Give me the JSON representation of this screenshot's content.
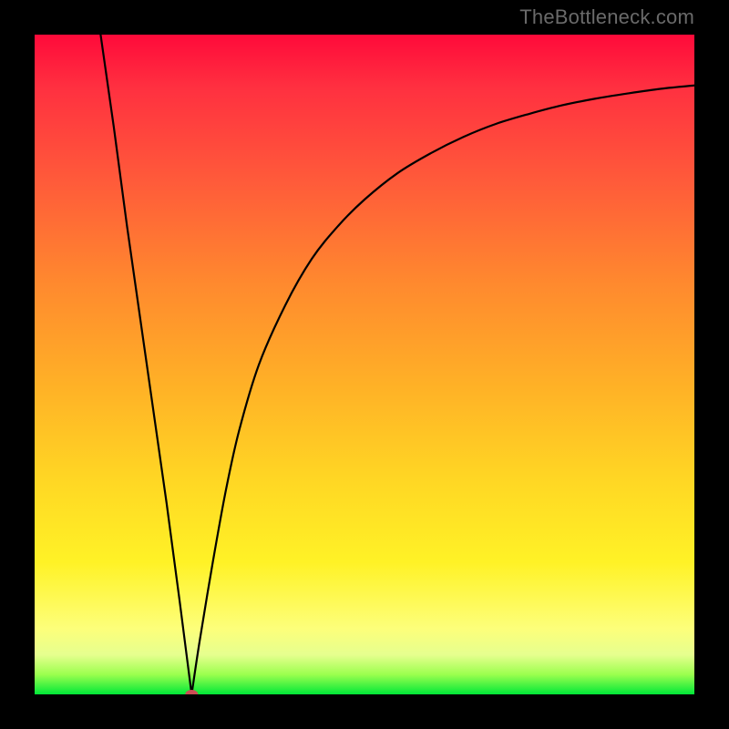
{
  "attribution": "TheBottleneck.com",
  "chart_data": {
    "type": "line",
    "title": "",
    "xlabel": "",
    "ylabel": "",
    "xlim": [
      0,
      100
    ],
    "ylim": [
      0,
      100
    ],
    "background_gradient": [
      "#ff0a3a",
      "#ff5a3a",
      "#ffb326",
      "#fff226",
      "#00e838"
    ],
    "x": [
      10,
      12,
      14,
      16,
      18,
      20,
      22,
      23.8,
      25,
      27,
      29,
      31,
      34,
      38,
      42,
      46,
      50,
      55,
      60,
      65,
      70,
      75,
      80,
      85,
      90,
      95,
      100
    ],
    "values": [
      100,
      86,
      71,
      57,
      43,
      29,
      14,
      0,
      8,
      20,
      31,
      40,
      50,
      59,
      66,
      71,
      75,
      79,
      82,
      84.5,
      86.5,
      88,
      89.3,
      90.3,
      91.1,
      91.8,
      92.3
    ],
    "marker": {
      "x": 23.8,
      "y": 0,
      "color": "#cc4d55"
    }
  }
}
